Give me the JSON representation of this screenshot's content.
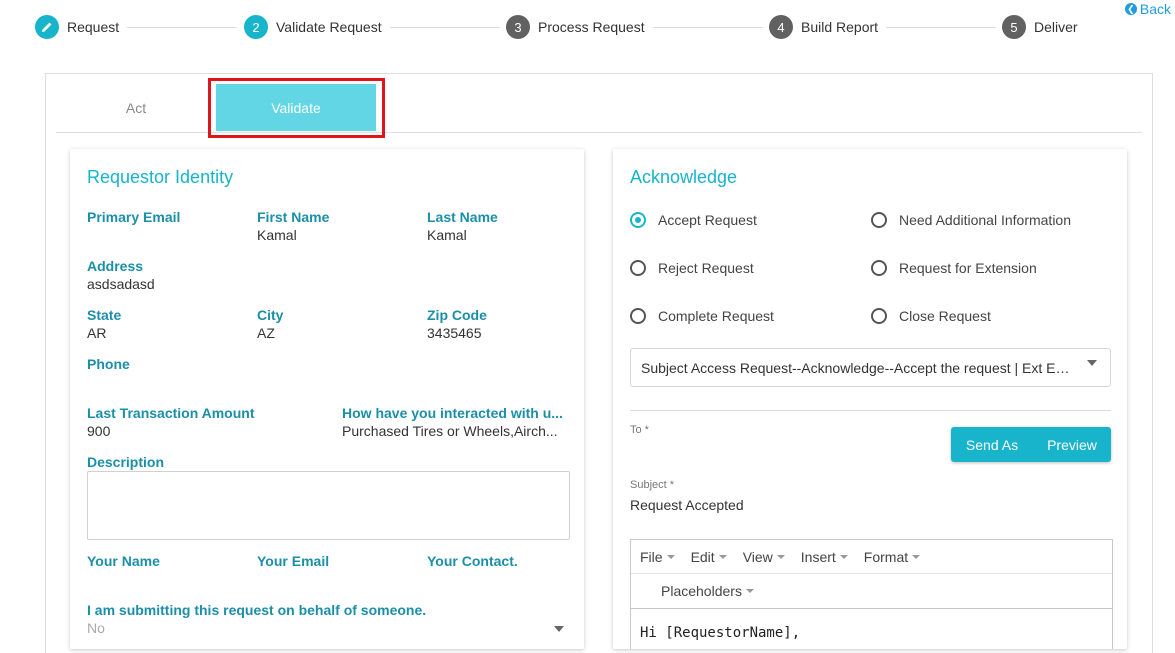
{
  "stepper": {
    "steps": [
      {
        "number": "",
        "label": "Request",
        "state": "done"
      },
      {
        "number": "2",
        "label": "Validate Request",
        "state": "active"
      },
      {
        "number": "3",
        "label": "Process Request",
        "state": "todo"
      },
      {
        "number": "4",
        "label": "Build Report",
        "state": "todo"
      },
      {
        "number": "5",
        "label": "Deliver",
        "state": "todo"
      }
    ],
    "back_label": "Back"
  },
  "tabs": {
    "act": "Act",
    "validate": "Validate"
  },
  "identity": {
    "title": "Requestor Identity",
    "primary_email": {
      "label": "Primary Email",
      "value": ""
    },
    "first_name": {
      "label": "First Name",
      "value": "Kamal"
    },
    "last_name": {
      "label": "Last Name",
      "value": "Kamal"
    },
    "address": {
      "label": "Address",
      "value": "asdsadasd"
    },
    "state": {
      "label": "State",
      "value": "AR"
    },
    "city": {
      "label": "City",
      "value": "AZ"
    },
    "zip": {
      "label": "Zip Code",
      "value": "3435465"
    },
    "phone": {
      "label": "Phone",
      "value": ""
    },
    "last_txn": {
      "label": "Last Transaction Amount",
      "value": "900"
    },
    "interaction": {
      "label": "How have you interacted with u...",
      "value": "Purchased Tires or Wheels,Airch..."
    },
    "description": {
      "label": "Description",
      "value": ""
    },
    "your_name": {
      "label": "Your Name"
    },
    "your_email": {
      "label": "Your Email"
    },
    "your_contact": {
      "label": "Your Contact."
    },
    "on_behalf": {
      "label": "I am submitting this request on behalf of someone.",
      "value": "No"
    }
  },
  "acknowledge": {
    "title": "Acknowledge",
    "options": [
      {
        "label": "Accept Request",
        "checked": true
      },
      {
        "label": "Need Additional Information",
        "checked": false
      },
      {
        "label": "Reject Request",
        "checked": false
      },
      {
        "label": "Request for Extension",
        "checked": false
      },
      {
        "label": "Complete Request",
        "checked": false
      },
      {
        "label": "Close Request",
        "checked": false
      }
    ],
    "template": "Subject Access Request--Acknowledge--Accept the request | Ext Email",
    "to_label": "To *",
    "send_as": "Send As",
    "preview": "Preview",
    "subject_label": "Subject *",
    "subject_value": "Request Accepted",
    "editor": {
      "menus": [
        "File",
        "Edit",
        "View",
        "Insert",
        "Format"
      ],
      "placeholders": "Placeholders",
      "body": "Hi [RequestorName],"
    }
  },
  "colors": {
    "accent": "#17b4cc",
    "label": "#1b8fa8",
    "highlight": "#e0151b"
  }
}
